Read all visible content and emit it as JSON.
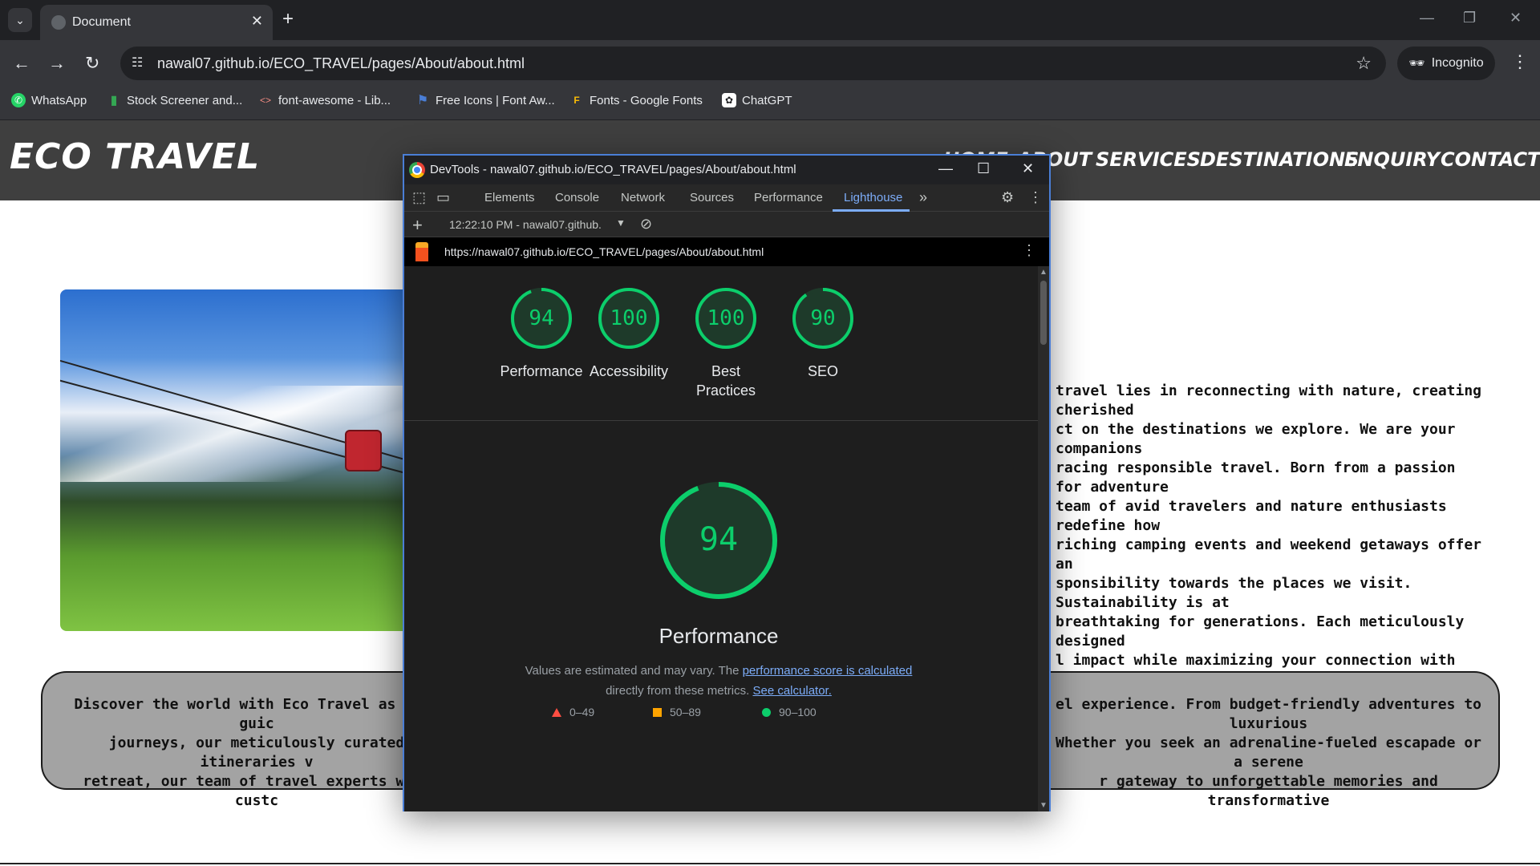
{
  "browser": {
    "tab_title": "Document",
    "url": "nawal07.github.io/ECO_TRAVEL/pages/About/about.html",
    "incognito_label": "Incognito",
    "bookmarks": [
      {
        "label": "WhatsApp",
        "icon": "whatsapp-icon",
        "color": "#25d366"
      },
      {
        "label": "Stock Screener and...",
        "icon": "bar-chart-icon",
        "color": "#34a853"
      },
      {
        "label": "font-awesome - Lib...",
        "icon": "code-brackets-icon",
        "color": "#f28b82"
      },
      {
        "label": "Free Icons | Font Aw...",
        "icon": "flag-icon",
        "color": "#4a7ed6"
      },
      {
        "label": "Fonts - Google Fonts",
        "icon": "google-fonts-icon",
        "color": "#fbbc05"
      },
      {
        "label": "ChatGPT",
        "icon": "chatgpt-icon",
        "color": "#ffffff"
      }
    ]
  },
  "site": {
    "logo": "ECO TRAVEL",
    "nav": [
      "HOME",
      "ABOUT",
      "SERVICES",
      "DESTINATIONS",
      "ENQUIRY",
      "CONTACT"
    ],
    "about_text": "travel lies in reconnecting with nature, creating cherished\nct on the destinations we explore. We are your companions\nracing responsible travel. Born from a passion for adventure\nteam of avid travelers and nature enthusiasts redefine how\nriching camping events and weekend getaways offer an\nsponsibility towards the places we visit. Sustainability is at\nbreathtaking for generations. Each meticulously designed\nl impact while maximizing your connection with nature,\nventure seekers and luxury enthusiasts.",
    "info_left": "Discover the world with Eco Travel as your guic\njourneys, our meticulously curated itineraries v\nretreat, our team of travel experts will custc",
    "info_right": "el experience. From budget-friendly adventures to luxurious\nWhether you seek an adrenaline-fueled escapade or a serene\nr gateway to unforgettable memories and transformative"
  },
  "devtools": {
    "window_title": "DevTools - nawal07.github.io/ECO_TRAVEL/pages/About/about.html",
    "tabs": [
      "Elements",
      "Console",
      "Network",
      "Sources",
      "Performance",
      "Lighthouse"
    ],
    "active_tab": "Lighthouse",
    "report_selector": "12:22:10 PM - nawal07.github.",
    "report_url": "https://nawal07.github.io/ECO_TRAVEL/pages/About/about.html",
    "scores": [
      {
        "label": "Performance",
        "value": 94
      },
      {
        "label": "Accessibility",
        "value": 100
      },
      {
        "label": "Best Practices",
        "value": 100
      },
      {
        "label": "SEO",
        "value": 90
      }
    ],
    "main_score": {
      "label": "Performance",
      "value": 94
    },
    "description_prefix": "Values are estimated and may vary. The ",
    "description_link1": "performance score is calculated",
    "description_middle": "directly from these metrics. ",
    "description_link2": "See calculator.",
    "legend": [
      {
        "label": "0–49",
        "shape": "triangle",
        "color": "#ff4e42"
      },
      {
        "label": "50–89",
        "shape": "square",
        "color": "#ffa400"
      },
      {
        "label": "90–100",
        "shape": "circle",
        "color": "#0cce6b"
      }
    ],
    "pass_color": "#0cce6b"
  }
}
